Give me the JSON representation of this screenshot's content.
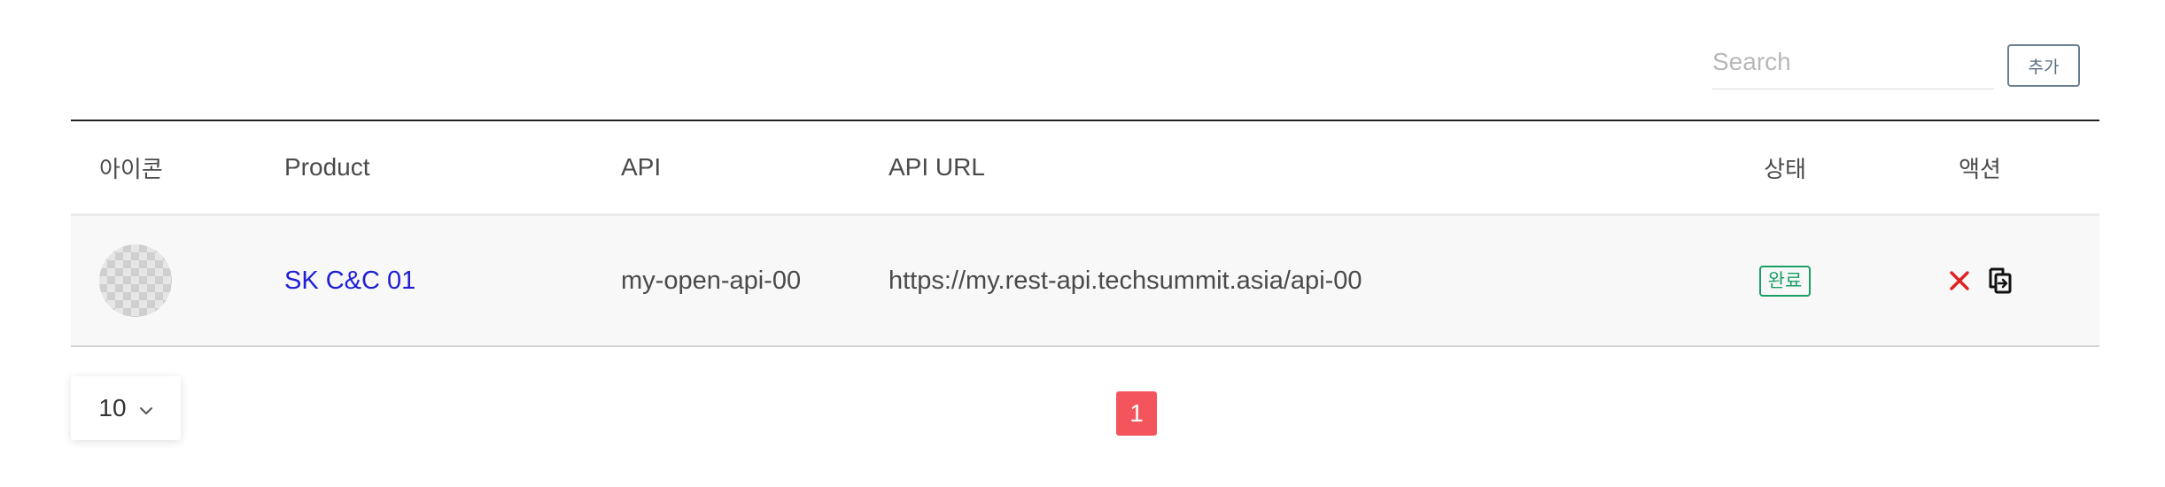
{
  "toolbar": {
    "search_placeholder": "Search",
    "search_value": "",
    "add_label": "추가"
  },
  "table": {
    "columns": {
      "icon": "아이콘",
      "product": "Product",
      "api": "API",
      "api_url": "API URL",
      "status": "상태",
      "action": "액션"
    },
    "rows": [
      {
        "product": "SK C&C 01",
        "api": "my-open-api-00",
        "api_url": "https://my.rest-api.techsummit.asia/api-00",
        "status": "완료",
        "actions": [
          "close-icon",
          "copy-icon"
        ]
      }
    ]
  },
  "footer": {
    "page_size": "10",
    "pages": [
      "1"
    ],
    "current_page": "1"
  },
  "colors": {
    "link": "#1f1fd6",
    "status_ok": "#1a9f66",
    "delete": "#e02020",
    "page_active": "#f4545c",
    "header_border": "#222222"
  }
}
